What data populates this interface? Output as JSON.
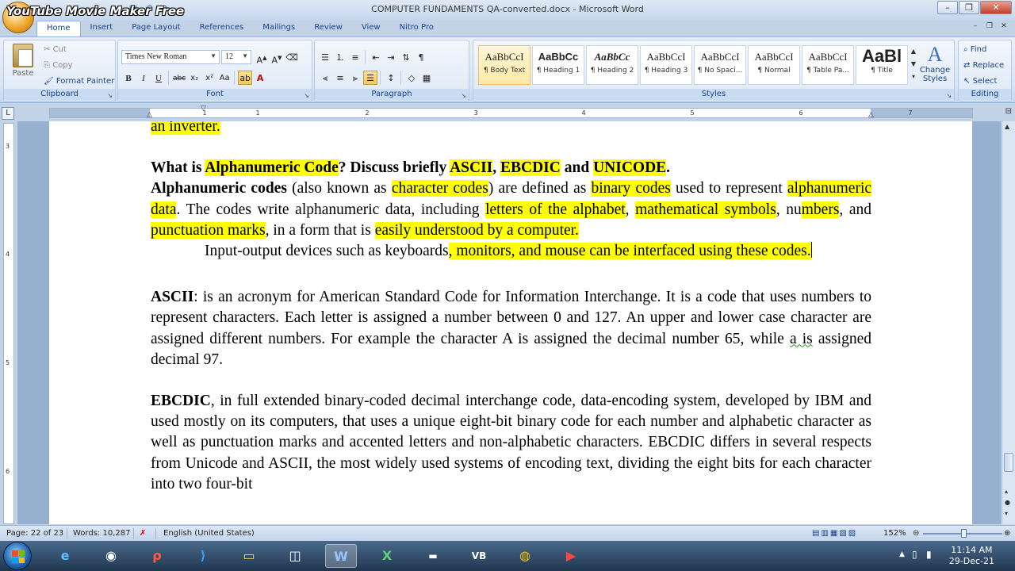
{
  "watermark": "YouTube Movie Maker Free",
  "window": {
    "title": "COMPUTER FUNDAMENTS QA-converted.docx - Microsoft Word",
    "minimize": "–",
    "maximize": "❐",
    "close": "✕"
  },
  "tabs": [
    "Home",
    "Insert",
    "Page Layout",
    "References",
    "Mailings",
    "Review",
    "View",
    "Nitro Pro"
  ],
  "clipboard": {
    "label": "Clipboard",
    "paste": "Paste",
    "cut": "Cut",
    "copy": "Copy",
    "format_painter": "Format Painter"
  },
  "font": {
    "label": "Font",
    "name": "Times New Roman",
    "size": "12"
  },
  "paragraph": {
    "label": "Paragraph"
  },
  "styles": {
    "label": "Styles",
    "items": [
      {
        "sample": "AaBbCcI",
        "name": "¶ Body Text"
      },
      {
        "sample": "AaBbCc",
        "name": "¶ Heading 1"
      },
      {
        "sample": "AaBbCc",
        "name": "¶ Heading 2"
      },
      {
        "sample": "AaBbCcI",
        "name": "¶ Heading 3"
      },
      {
        "sample": "AaBbCcI",
        "name": "¶ No Spaci..."
      },
      {
        "sample": "AaBbCcI",
        "name": "¶ Normal"
      },
      {
        "sample": "AaBbCcI",
        "name": "¶ Table Pa..."
      },
      {
        "sample": "AaBl",
        "name": "¶ Title"
      }
    ],
    "change_styles": "Change Styles"
  },
  "editing": {
    "label": "Editing",
    "find": "Find",
    "replace": "Replace",
    "select": "Select"
  },
  "ruler_ticks": [
    "1",
    "1",
    "2",
    "3",
    "4",
    "5",
    "6",
    "7"
  ],
  "vruler_ticks": [
    "3",
    "4",
    "5",
    "6"
  ],
  "document": {
    "line0": "an inverter.",
    "q_prefix": "What is ",
    "q_alpha": "Alphanumeric Code",
    "q_mid": "? Discuss briefly ",
    "q_ascii": "ASCII",
    "q_comma": ", ",
    "q_ebcdic": "EBCDIC",
    "q_and": " and ",
    "q_unicode": "UNICODE",
    "q_end": ".",
    "p1_a": "Alphanumeric codes",
    "p1_b": " (also known as ",
    "p1_c": "character codes",
    "p1_d": ") are defined as ",
    "p1_e": "binary codes",
    "p1_f": " used to represent ",
    "p1_g": "alphanumeric data",
    "p1_h": ". The codes write alphanumeric data, including ",
    "p1_i": "letters of the alphabet",
    "p1_j": ", ",
    "p1_k": "mathematical symbols",
    "p1_l": ", nu",
    "p1_m": "mbers",
    "p1_n": ", and ",
    "p1_o": "punctuation marks",
    "p1_p": ", in a form that is ",
    "p1_q": "easily understood by a computer.",
    "p2_a": "Input-output devices such as keyboards",
    "p2_b": ", monitors, and mouse can be interfaced using these codes.",
    "p3_a": "ASCII",
    "p3_b": ": is an acronym for American Standard Code for Information Interchange. It is a code that uses numbers to represent characters. Each letter is assigned a number between 0 and 127. An upper and lower case character are assigned different numbers. For example the character A is assigned the decimal number 65, while ",
    "p3_c": "a is",
    "p3_d": " assigned decimal 97.",
    "p4_a": "EBCDIC",
    "p4_b": ", in full extended binary-coded decimal interchange code, data-encoding system, developed by IBM and used mostly on its computers, that uses a unique eight-bit binary code for each number and alphabetic character as well as punctuation marks and accented letters and non-alphabetic characters. EBCDIC differs in several respects from Unicode and ASCII, the most widely used systems of encoding text, dividing the eight bits for each character into two four-bit"
  },
  "status": {
    "page": "Page: 22 of 23",
    "words": "Words: 10,287",
    "language": "English (United States)",
    "zoom": "152%"
  },
  "taskbar": {
    "time": "11:14 AM",
    "date": "29-Dec-21"
  }
}
